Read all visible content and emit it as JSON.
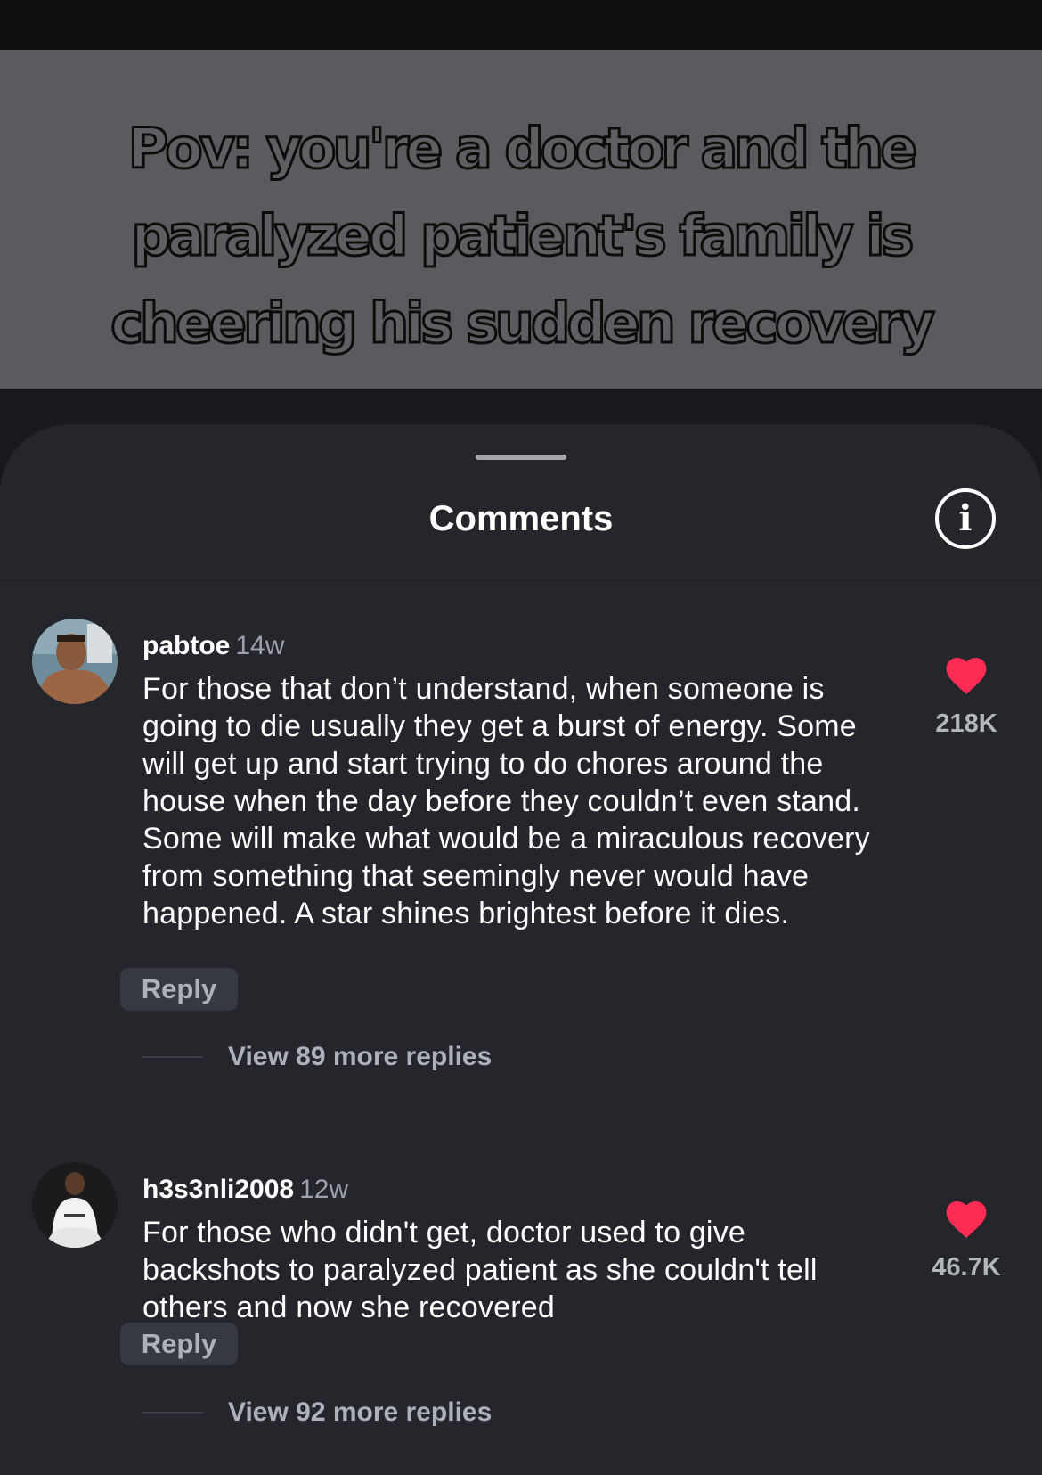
{
  "video": {
    "caption": "Pov: you're a doctor and the paralyzed patient's family is cheering his sudden recovery"
  },
  "sheet": {
    "title": "Comments"
  },
  "comments": [
    {
      "username": "pabtoe",
      "age": "14w",
      "text": "For those that don’t understand, when someone is going to die usually they get a burst of energy. Some will get up and start trying to do chores around the house when the day before they couldn’t even stand. Some will make what would be a miraculous recovery from something that seemingly never would have happened. A star shines brightest before it dies.",
      "reply_label": "Reply",
      "view_replies": "View 89 more replies",
      "likes": "218K",
      "like_color": "#fe2c55"
    },
    {
      "username": "h3s3nli2008",
      "age": "12w",
      "text": "For those who didn't get, doctor used to give backshots to paralyzed patient as she couldn't tell others and now she recovered",
      "reply_label": "Reply",
      "view_replies": "View 92 more replies",
      "likes": "46.7K",
      "like_color": "#fe2c55"
    }
  ]
}
